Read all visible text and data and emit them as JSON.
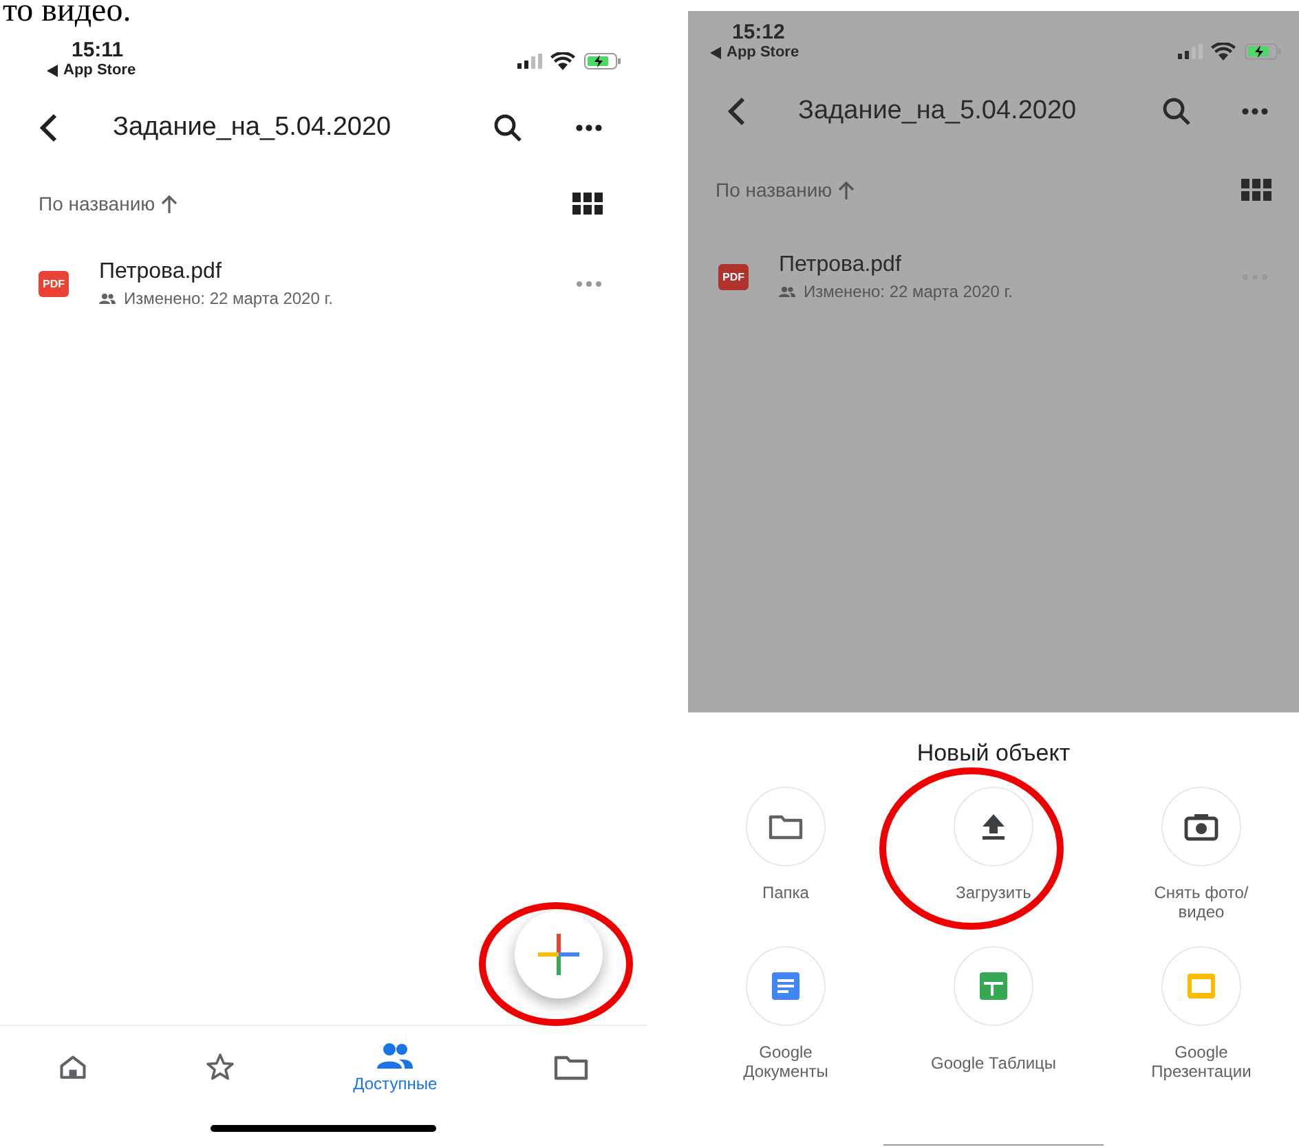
{
  "document_text": "то видео.",
  "screens": [
    {
      "dimmed": false,
      "status_bar": {
        "time": "15:11",
        "back_label": "App Store"
      },
      "toolbar": {
        "title": "Задание_на_5.04.2020"
      },
      "sort": {
        "label": "По названию"
      },
      "files": [
        {
          "type_badge": "PDF",
          "name": "Петрова.pdf",
          "modified": "Изменено: 22 марта 2020 г.",
          "shared": true
        }
      ],
      "fab": {
        "circled": true
      },
      "bottom_nav": [
        {
          "kind": "home",
          "selected": false
        },
        {
          "kind": "starred",
          "selected": false
        },
        {
          "kind": "shared",
          "selected": true,
          "label": "Доступные"
        },
        {
          "kind": "files",
          "selected": false
        }
      ]
    },
    {
      "dimmed": true,
      "status_bar": {
        "time": "15:12",
        "back_label": "App Store"
      },
      "toolbar": {
        "title": "Задание_на_5.04.2020"
      },
      "sort": {
        "label": "По названию"
      },
      "files": [
        {
          "type_badge": "PDF",
          "name": "Петрова.pdf",
          "modified": "Изменено: 22 марта 2020 г.",
          "shared": true
        }
      ],
      "new_sheet": {
        "title": "Новый объект",
        "items": [
          {
            "kind": "folder",
            "label": "Папка",
            "circled": false
          },
          {
            "kind": "upload",
            "label": "Загрузить",
            "circled": true
          },
          {
            "kind": "camera",
            "label": "Снять фото/\nвидео",
            "circled": false
          },
          {
            "kind": "docs",
            "label": "Google\nДокументы",
            "circled": false
          },
          {
            "kind": "sheets",
            "label": "Google Таблицы",
            "circled": false
          },
          {
            "kind": "slides",
            "label": "Google\nПрезентации",
            "circled": false
          }
        ]
      }
    }
  ]
}
